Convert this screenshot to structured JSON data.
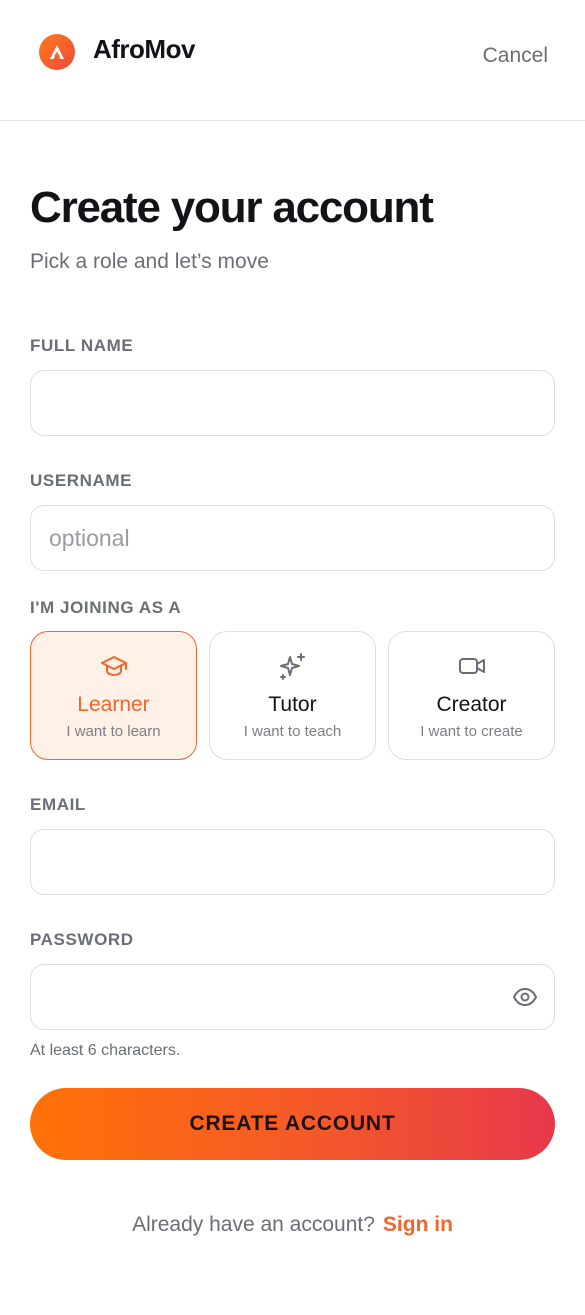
{
  "header": {
    "brand": "AfroMov",
    "cancel_label": "Cancel"
  },
  "page": {
    "title": "Create your account",
    "subtitle": "Pick a role and let’s move"
  },
  "form": {
    "full_name": {
      "label": "FULL NAME",
      "value": "",
      "placeholder": ""
    },
    "username": {
      "label": "USERNAME",
      "value": "",
      "placeholder": "optional"
    },
    "role": {
      "label": "I'M JOINING AS A",
      "selected": "Learner",
      "options": [
        {
          "name": "Learner",
          "description": "I want to learn",
          "icon": "graduation-cap-icon"
        },
        {
          "name": "Tutor",
          "description": "I want to teach",
          "icon": "sparkles-icon"
        },
        {
          "name": "Creator",
          "description": "I want to create",
          "icon": "video-camera-icon"
        }
      ]
    },
    "email": {
      "label": "EMAIL",
      "value": "",
      "placeholder": ""
    },
    "password": {
      "label": "PASSWORD",
      "value": "",
      "placeholder": "",
      "hint": "At least 6 characters.",
      "toggle_icon": "eye-icon"
    }
  },
  "submit_label": "CREATE ACCOUNT",
  "footer": {
    "prompt": "Already have an account?",
    "link": "Sign in"
  },
  "colors": {
    "accent": "#f2662b",
    "gradient_start": "#ff7207",
    "gradient_end": "#e7384a",
    "selected_bg": "#fff1e8"
  }
}
